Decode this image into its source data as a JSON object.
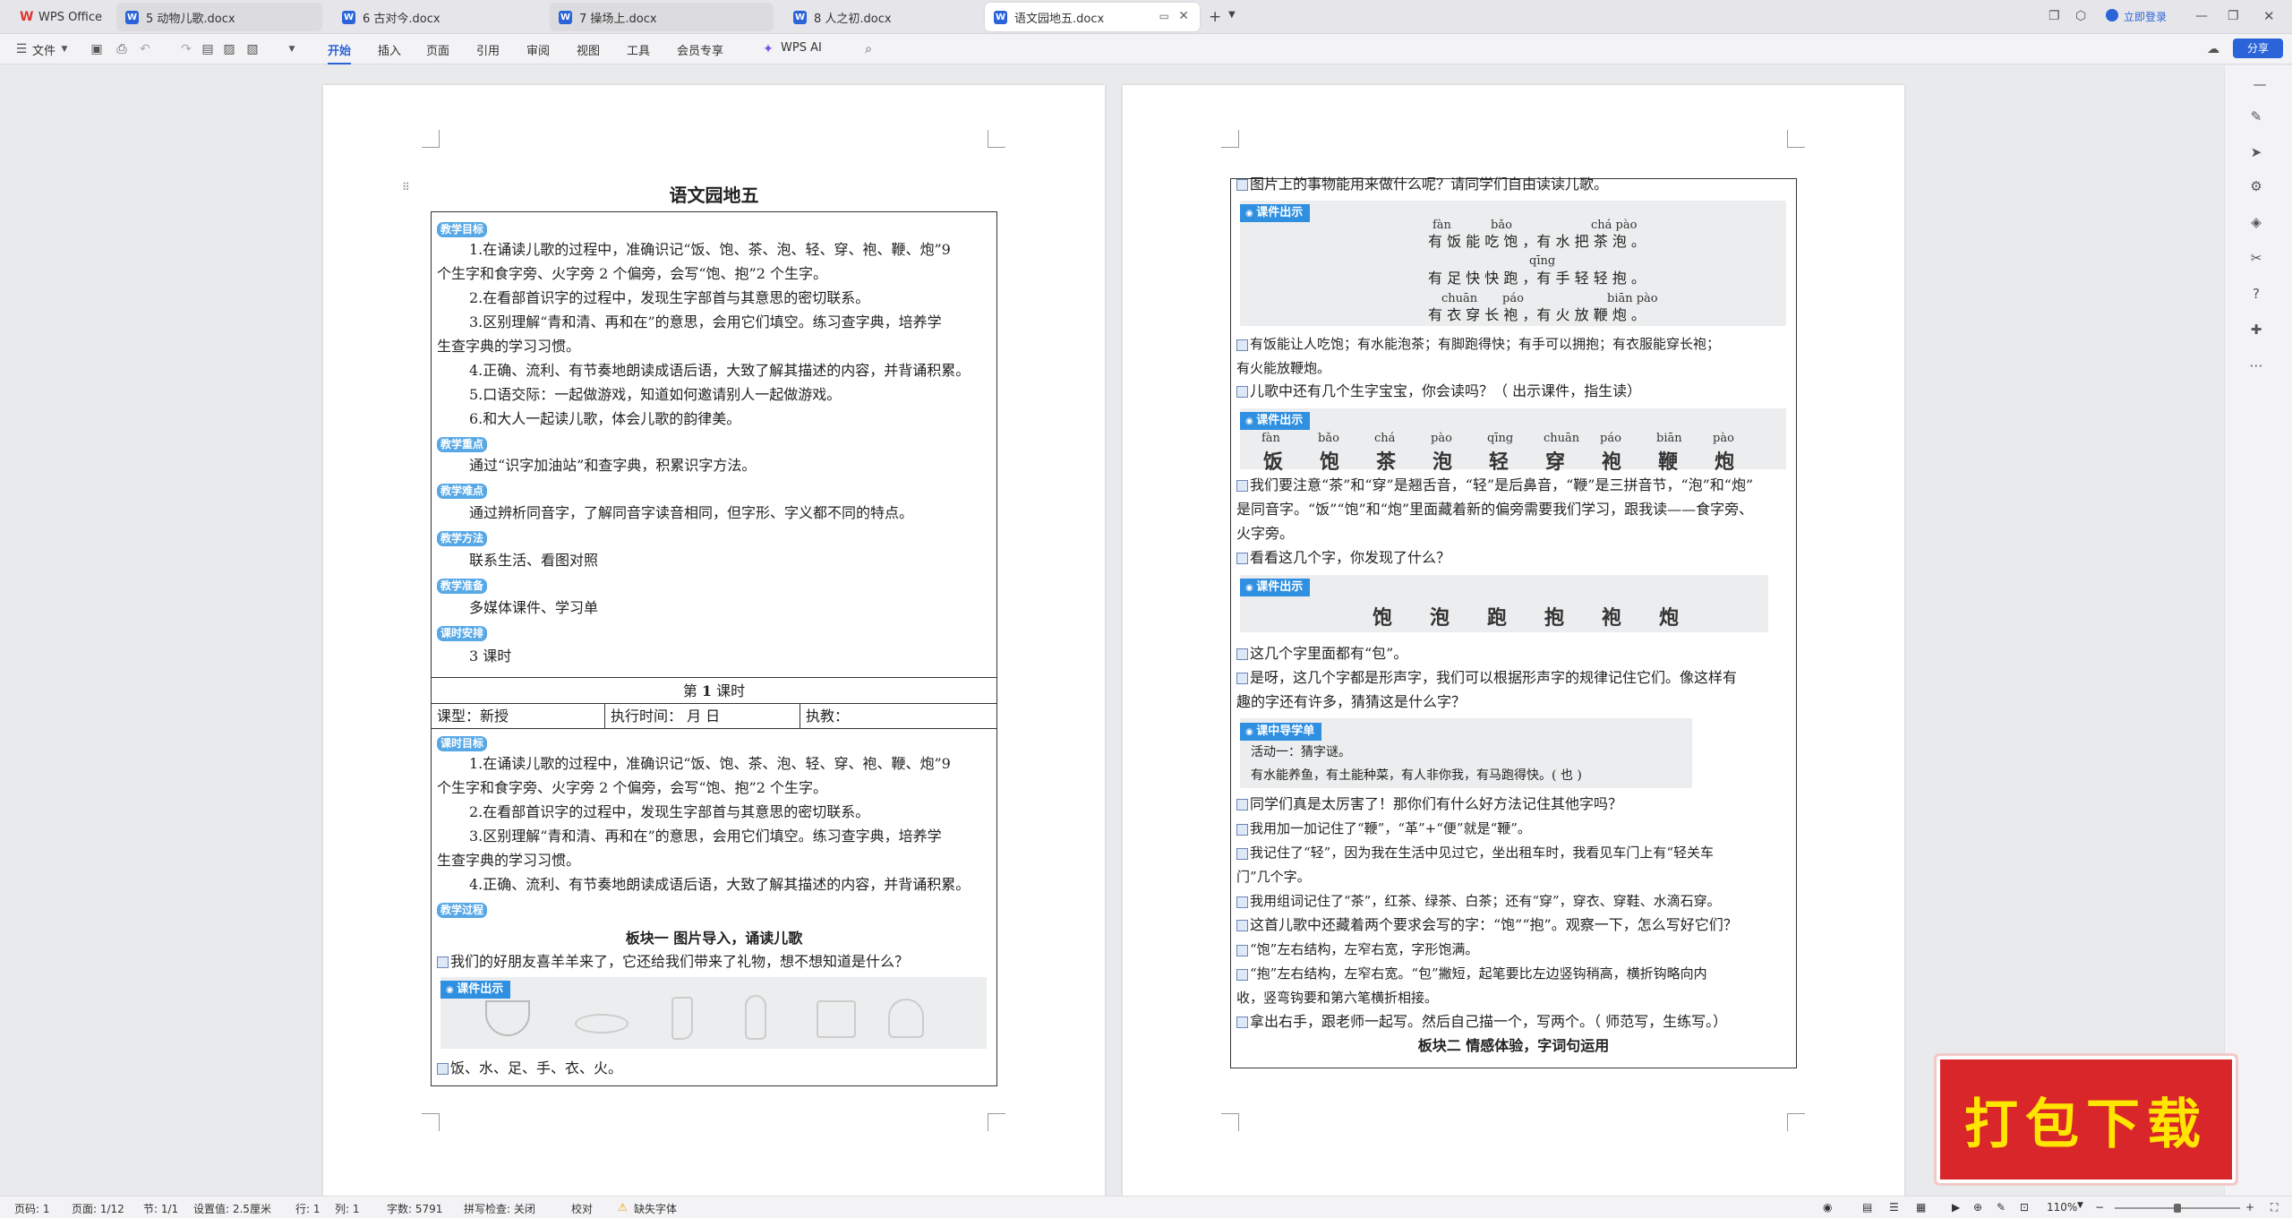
{
  "tabs": [
    {
      "label": "WPS Office",
      "icon": "wps-logo-icon"
    },
    {
      "label": "5 动物儿歌.docx",
      "icon": "word-doc-icon"
    },
    {
      "label": "6 古对今.docx",
      "icon": "word-doc-icon"
    },
    {
      "label": "7 操场上.docx",
      "icon": "word-doc-icon"
    },
    {
      "label": "8 人之初.docx",
      "icon": "word-doc-icon"
    },
    {
      "label": "语文园地五.docx",
      "icon": "word-doc-icon",
      "active": true
    }
  ],
  "titlebar": {
    "login": "立即登录"
  },
  "menu": {
    "file": "文件",
    "items": [
      "开始",
      "插入",
      "页面",
      "引用",
      "审阅",
      "视图",
      "工具",
      "会员专享"
    ],
    "active": "开始",
    "ai": "WPS AI",
    "share": "分享"
  },
  "left_page": {
    "title": "语文园地五",
    "sections": {
      "goal_tag": "教学目标",
      "goals": [
        "1.在诵读儿歌的过程中，准确识记“饭、饱、茶、泡、轻、穿、袍、鞭、炮”9",
        "个生字和食字旁、火字旁 2 个偏旁，会写“饱、抱”2 个生字。",
        "2.在看部首识字的过程中，发现生字部首与其意思的密切联系。",
        "3.区别理解“青和清、再和在”的意思，会用它们填空。练习查字典，培养学",
        "生查字典的学习习惯。",
        "4.正确、流利、有节奏地朗读成语后语，大致了解其描述的内容，并背诵积累。",
        "5.口语交际：一起做游戏，知道如何邀请别人一起做游戏。",
        "6.和大人一起读儿歌，体会儿歌的韵律美。"
      ],
      "key_tag": "教学重点",
      "key": "通过“识字加油站”和查字典，积累识字方法。",
      "diff_tag": "教学难点",
      "diff": "通过辨析同音字，了解同音字读音相同，但字形、字义都不同的特点。",
      "method_tag": "教学方法",
      "method": "联系生活、看图对照",
      "prep_tag": "教学准备",
      "prep": "多媒体课件、学习单",
      "hours_tag": "课时安排",
      "hours": "3 课时"
    },
    "lesson": {
      "header_pre": "第",
      "header_num": "1",
      "header_post": "课时",
      "type": "课型：新授",
      "time": "执行时间：       月       日",
      "exec": "执教：",
      "goal_tag": "课时目标",
      "goals": [
        "1.在诵读儿歌的过程中，准确识记“饭、饱、茶、泡、轻、穿、袍、鞭、炮”9",
        "个生字和食字旁、火字旁 2 个偏旁，会写“饱、抱”2 个生字。",
        "2.在看部首识字的过程中，发现生字部首与其意思的密切联系。",
        "3.区别理解“青和清、再和在”的意思，会用它们填空。练习查字典，培养学",
        "生查字典的学习习惯。",
        "4.正确、流利、有节奏地朗读成语后语，大致了解其描述的内容，并背诵积累。"
      ],
      "process_tag": "教学过程",
      "block_title": "板块一  图片导入，诵读儿歌",
      "intro": "我们的好朋友喜羊羊来了，它还给我们带来了礼物，想不想知道是什么？",
      "courseware": "课件出示",
      "words": "饭、水、足、手、衣、火。"
    }
  },
  "right_page": {
    "q1": "图片上的事物能用来做什么呢？请同学们自由读读儿歌。",
    "courseware": "课件出示",
    "poem_pinyin": [
      [
        "fàn",
        "bǎo",
        "chá pào"
      ],
      [
        "qīng"
      ],
      [
        "chuān",
        "páo",
        "biān pào"
      ]
    ],
    "poem": [
      "有 饭 能 吃 饱 ，有 水 把 茶 泡 。",
      "有 足 快 快 跑 ，有 手 轻 轻 抱 。",
      "有 衣  穿  长  袍 ，有 火 放  鞭  炮 。"
    ],
    "a1a": "有饭能让人吃饱；有水能泡茶；有脚跑得快；有手可以拥抱；有衣服能穿长袍；",
    "a1b": "有火能放鞭炮。",
    "q2": "儿歌中还有几个生字宝宝，你会读吗？（ 出示课件，指生读）",
    "chars_pinyin": [
      "fàn",
      "bǎo",
      "chá",
      "pào",
      "qīng",
      "chuān",
      "páo",
      "biān",
      "pào"
    ],
    "chars": [
      "饭",
      "饱",
      "茶",
      "泡",
      "轻",
      "穿",
      "袍",
      "鞭",
      "炮"
    ],
    "p3a": "我们要注意“茶”和“穿”是翘舌音，“轻”是后鼻音，“鞭”是三拼音节，“泡”和“炮”",
    "p3b": "是同音字。“饭”“饱”和“炮”里面藏着新的偏旁需要我们学习，跟我读——食字旁、",
    "p3c": "火字旁。",
    "q4": "看看这几个字，你发现了什么？",
    "chars2": [
      "饱",
      "泡",
      "跑",
      "抱",
      "袍",
      "炮"
    ],
    "a4": "这几个字里面都有“包”。",
    "p5a": "是呀，这几个字都是形声字，我们可以根据形声字的规律记住它们。像这样有",
    "p5b": "趣的字还有许多，猜猜这是什么字？",
    "worksheet": "课中导学单",
    "act1": "活动一：猜字谜。",
    "riddle": "有水能养鱼，有土能种菜，有人非你我，有马跑得快。(  也  )",
    "q6": "同学们真是太厉害了！那你们有什么好方法记住其他字吗？",
    "a6": "我用加一加记住了“鞭”，“革”+“便”就是“鞭”。",
    "a7a": "我记住了“轻”，因为我在生活中见过它，坐出租车时，我看见车门上有“轻关车",
    "a7b": "门”几个字。",
    "a8": "我用组词记住了“茶”，红茶、绿茶、白茶；还有“穿”，穿衣、穿鞋、水滴石穿。",
    "q9": "这首儿歌中还藏着两个要求会写的字：“饱”“抱”。观察一下，怎么写好它们？",
    "a9": "“饱”左右结构，左窄右宽，字形饱满。",
    "a10a": "“抱”左右结构，左窄右宽。“包”撇短，起笔要比左边竖钩稍高，横折钩略向内",
    "a10b": "收，竖弯钩要和第六笔横折相接。",
    "p11": "拿出右手，跟老师一起写。然后自己描一个，写两个。（ 师范写，生练写。）",
    "block2": "板块二  情感体验，字词句运用"
  },
  "status": {
    "page": "页码: 1",
    "pages": "页面: 1/12",
    "section": "节: 1/1",
    "setting": "设置值: 2.5厘米",
    "row": "行: 1",
    "col": "列: 1",
    "words": "字数: 5791",
    "spell": "拼写检查: 关闭",
    "proof": "校对",
    "font": "缺失字体",
    "zoom": "110%"
  },
  "badge": {
    "text": "打包下载"
  }
}
